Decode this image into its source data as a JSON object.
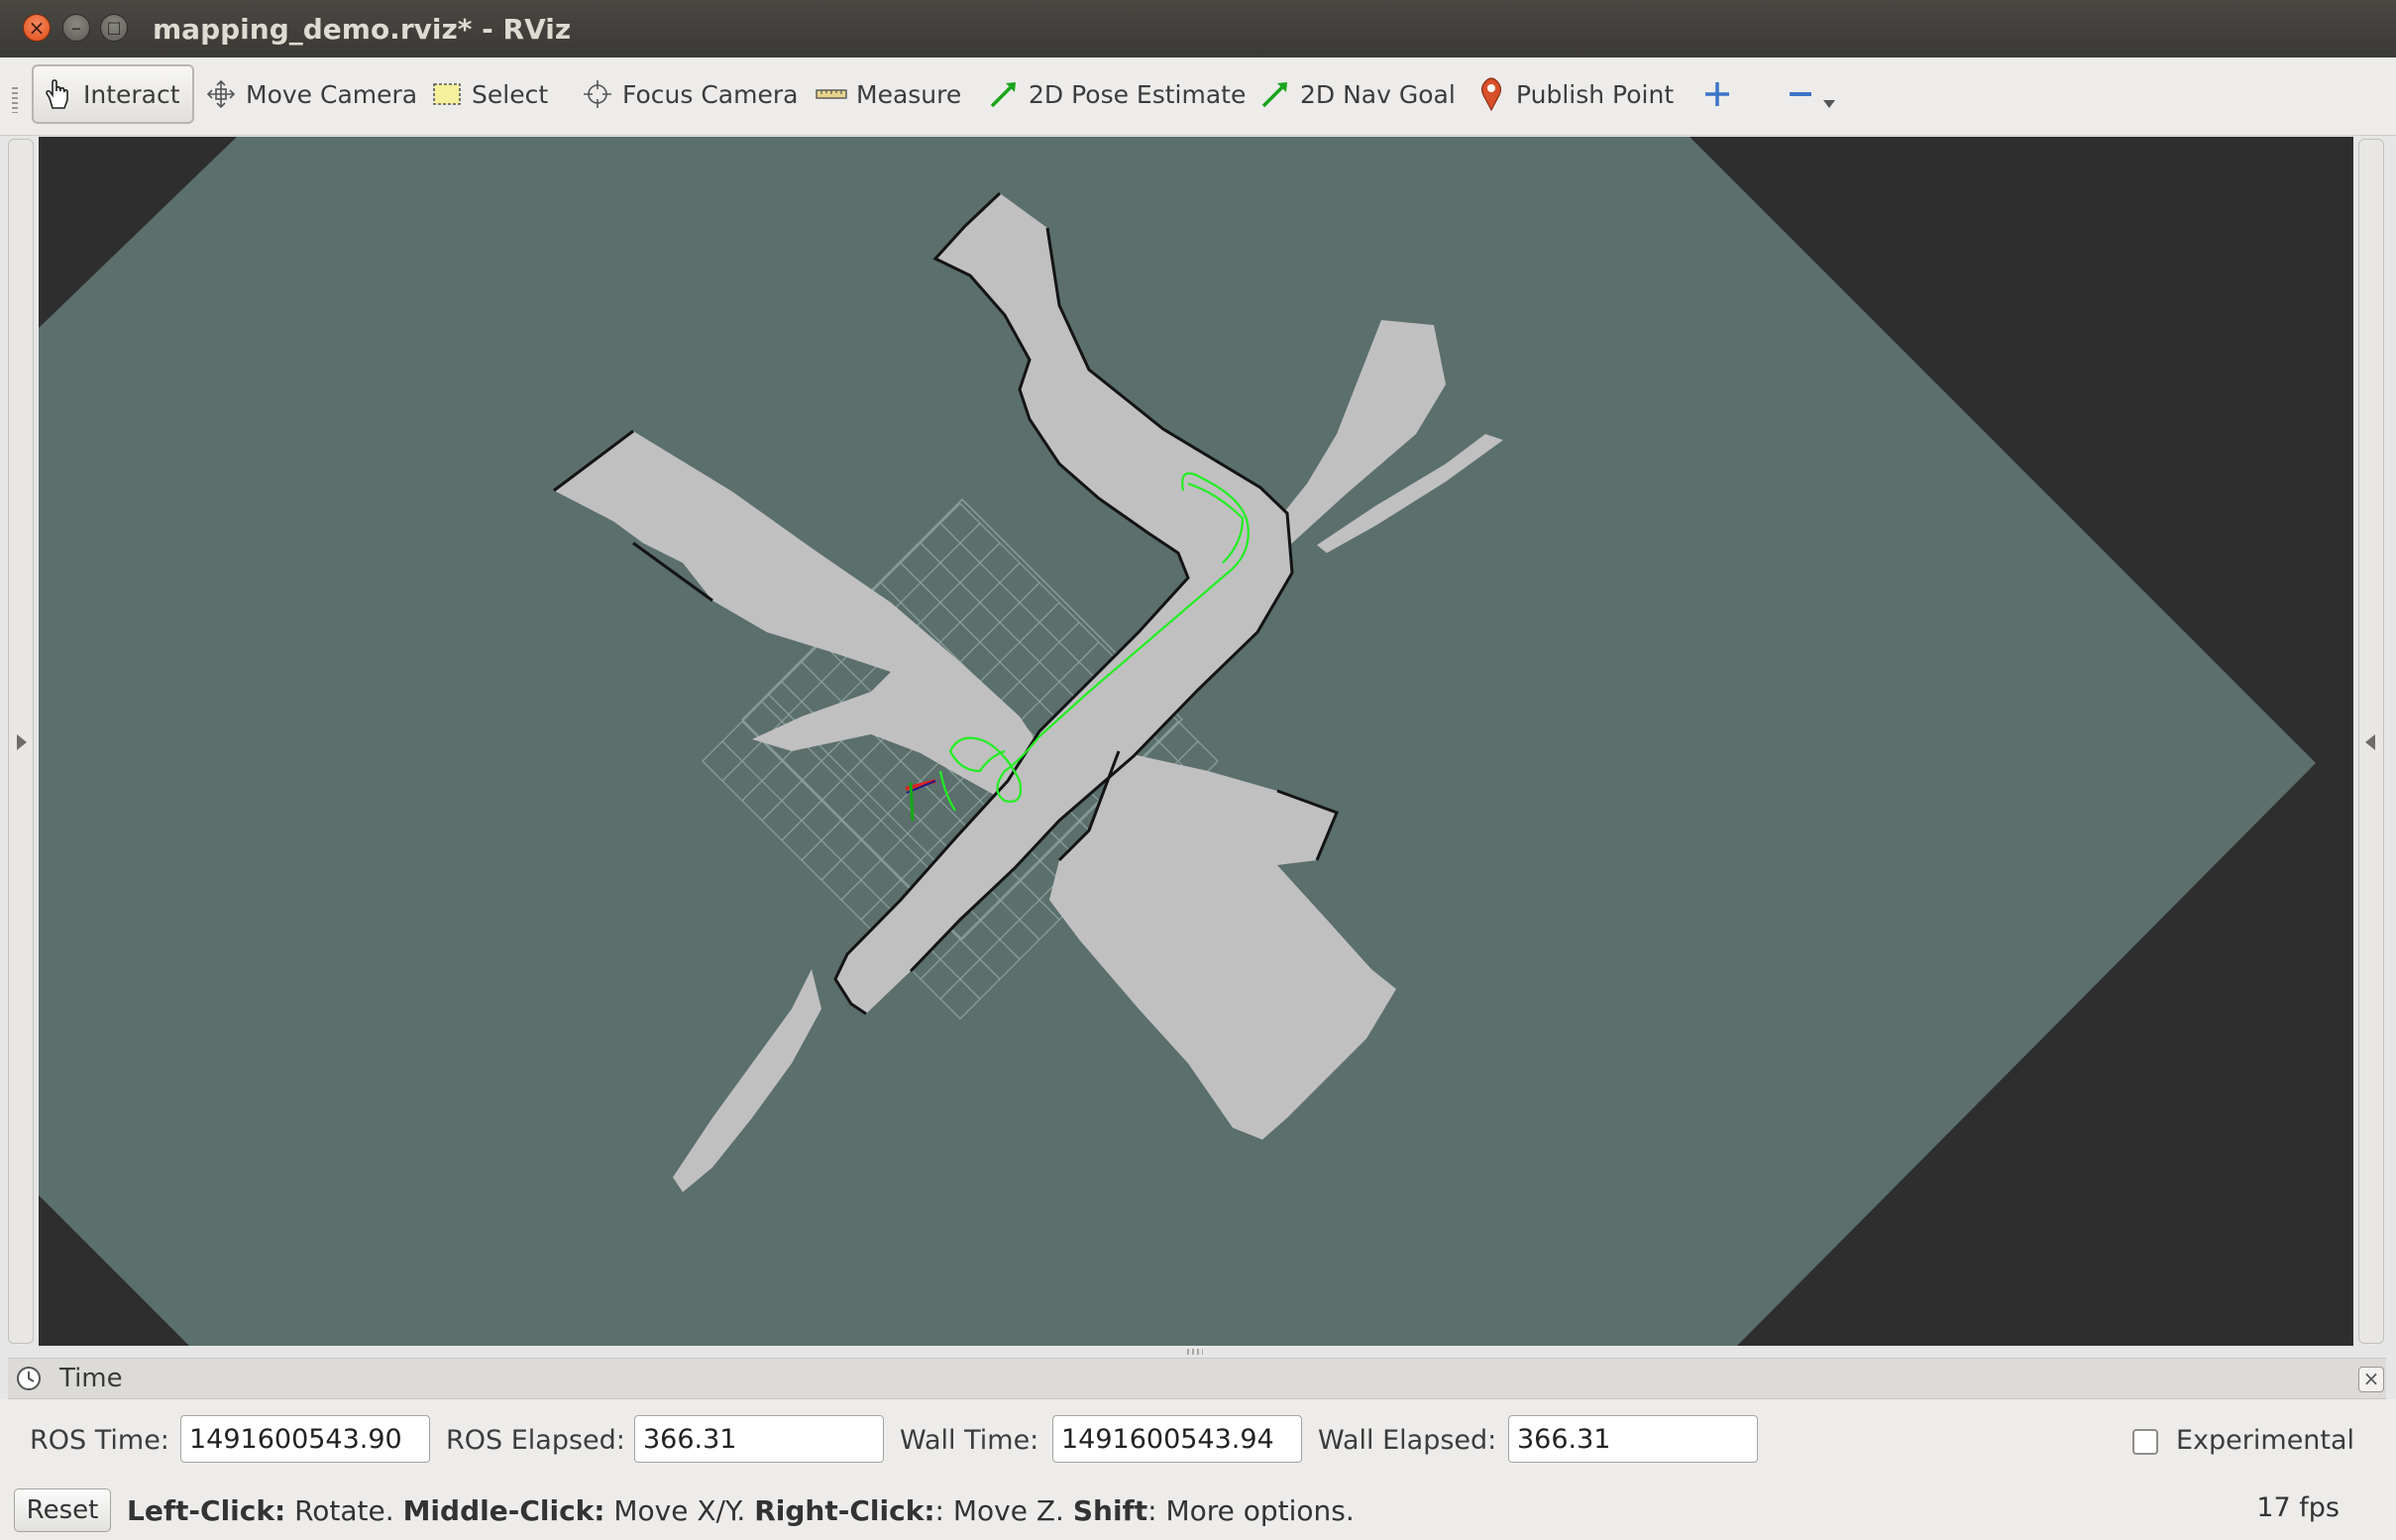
{
  "window": {
    "title": "mapping_demo.rviz* - RViz"
  },
  "toolbar": {
    "tools": [
      {
        "label": "Interact",
        "icon": "hand-icon"
      },
      {
        "label": "Move Camera",
        "icon": "move-camera-icon"
      },
      {
        "label": "Select",
        "icon": "select-box-icon"
      },
      {
        "label": "Focus Camera",
        "icon": "crosshair-icon"
      },
      {
        "label": "Measure",
        "icon": "ruler-icon"
      },
      {
        "label": "2D Pose Estimate",
        "icon": "green-arrow-icon"
      },
      {
        "label": "2D Nav Goal",
        "icon": "green-arrow-icon"
      },
      {
        "label": "Publish Point",
        "icon": "map-pin-icon"
      }
    ],
    "add_icon": "plus-icon",
    "remove_icon": "minus-icon",
    "dropdown_icon": "chevron-down-icon"
  },
  "time_panel": {
    "title": "Time",
    "ros_time_label": "ROS Time:",
    "ros_time": "1491600543.90",
    "ros_elapsed_label": "ROS Elapsed:",
    "ros_elapsed": "366.31",
    "wall_time_label": "Wall Time:",
    "wall_time": "1491600543.94",
    "wall_elapsed_label": "Wall Elapsed:",
    "wall_elapsed": "366.31",
    "experimental_label": "Experimental",
    "experimental_checked": false
  },
  "status": {
    "reset_label": "Reset",
    "hint_left_click": "Left-Click:",
    "hint_rotate": " Rotate. ",
    "hint_middle_click": "Middle-Click:",
    "hint_move_xy": " Move X/Y. ",
    "hint_right_click": "Right-Click:",
    "hint_move_z": ": Move Z. ",
    "hint_shift": "Shift",
    "hint_more": ": More options.",
    "fps": "17 fps"
  },
  "colors": {
    "map_unknown": "#5b6f6c",
    "map_free": "#c0c0c0",
    "map_occupied": "#111111",
    "path": "#22ee22",
    "background": "#2e2e2e"
  }
}
